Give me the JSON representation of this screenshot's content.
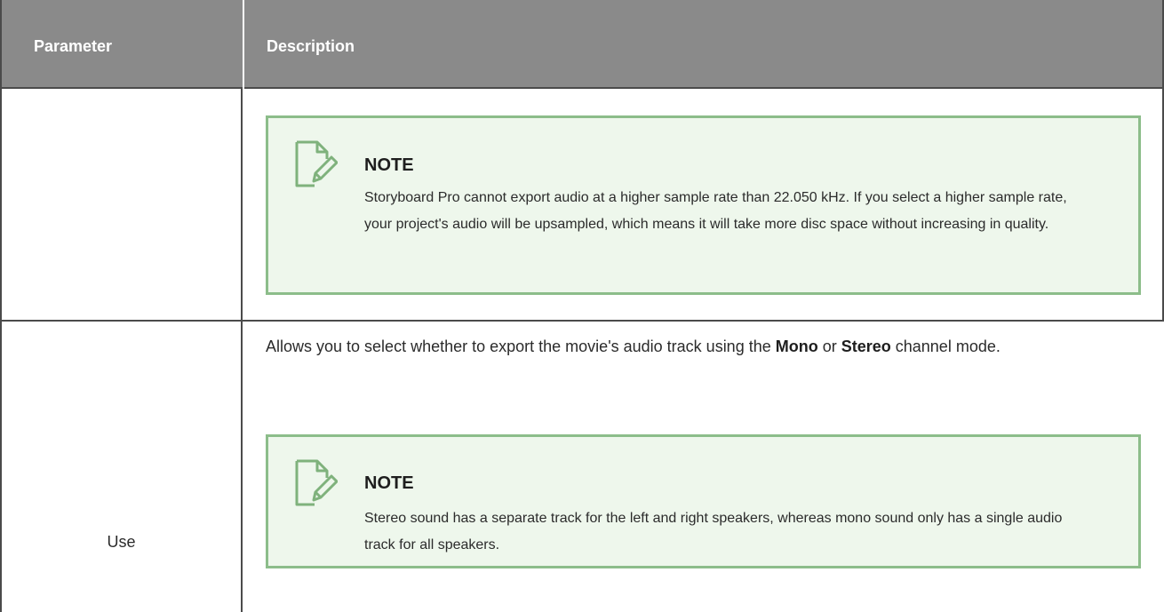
{
  "table": {
    "header": {
      "parameter": "Parameter",
      "description": "Description"
    },
    "rows": [
      {
        "parameter": "",
        "note": {
          "icon": "note-edit-icon",
          "title": "NOTE",
          "text": "Storyboard Pro cannot export audio at a higher sample rate than 22.050 kHz. If you select a higher sample rate, your project's audio will be upsampled, which means it will take more disc space without increasing in quality."
        }
      },
      {
        "parameter": "Use",
        "description": {
          "prefix": "Allows you to select whether to export the movie's audio track using the ",
          "bold_1": "Mono",
          "middle": " or ",
          "bold_2": "Stereo",
          "suffix": " channel mode."
        },
        "note": {
          "icon": "note-edit-icon",
          "title": "NOTE",
          "text": "Stereo sound has a separate track for the left and right speakers, whereas mono sound only has a single audio track for all speakers."
        }
      }
    ]
  },
  "colors": {
    "header_bg": "#8a8a8a",
    "border": "#4b4b4b",
    "note_bg": "#eef7ec",
    "note_border": "#8cbd8a",
    "note_icon": "#7fb27c"
  }
}
